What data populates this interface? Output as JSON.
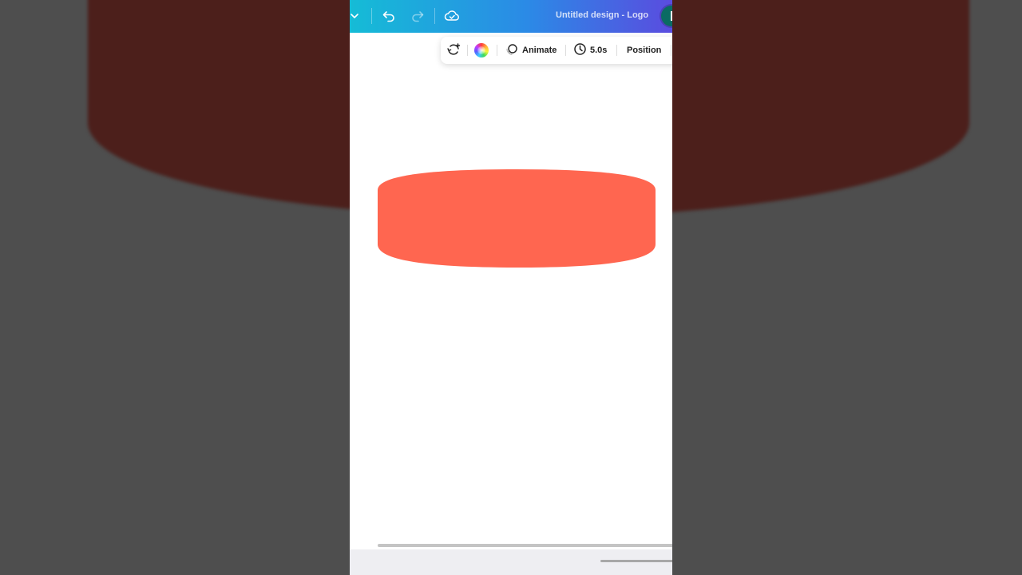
{
  "app": {
    "doc_title": "Untitled design - Logo"
  },
  "context_toolbar": {
    "animate_label": "Animate",
    "duration_label": "5.0s",
    "position_label": "Position"
  },
  "canvas": {
    "shape": "cylinder",
    "shape_color": "#ff6650",
    "background_color": "#ffffff"
  },
  "icons": {
    "menu": "chevron-down-icon",
    "undo": "undo-icon",
    "redo": "redo-icon",
    "save_status": "cloud-check-icon",
    "replace": "replace-icon",
    "color": "color-wheel-icon",
    "animate": "animate-icon",
    "duration": "clock-icon"
  },
  "colors": {
    "topbar_start": "#15bcd6",
    "topbar_end": "#5a4cdf",
    "side_background": "#4e4e4e",
    "side_shape_blur": "#4c1f1b"
  }
}
